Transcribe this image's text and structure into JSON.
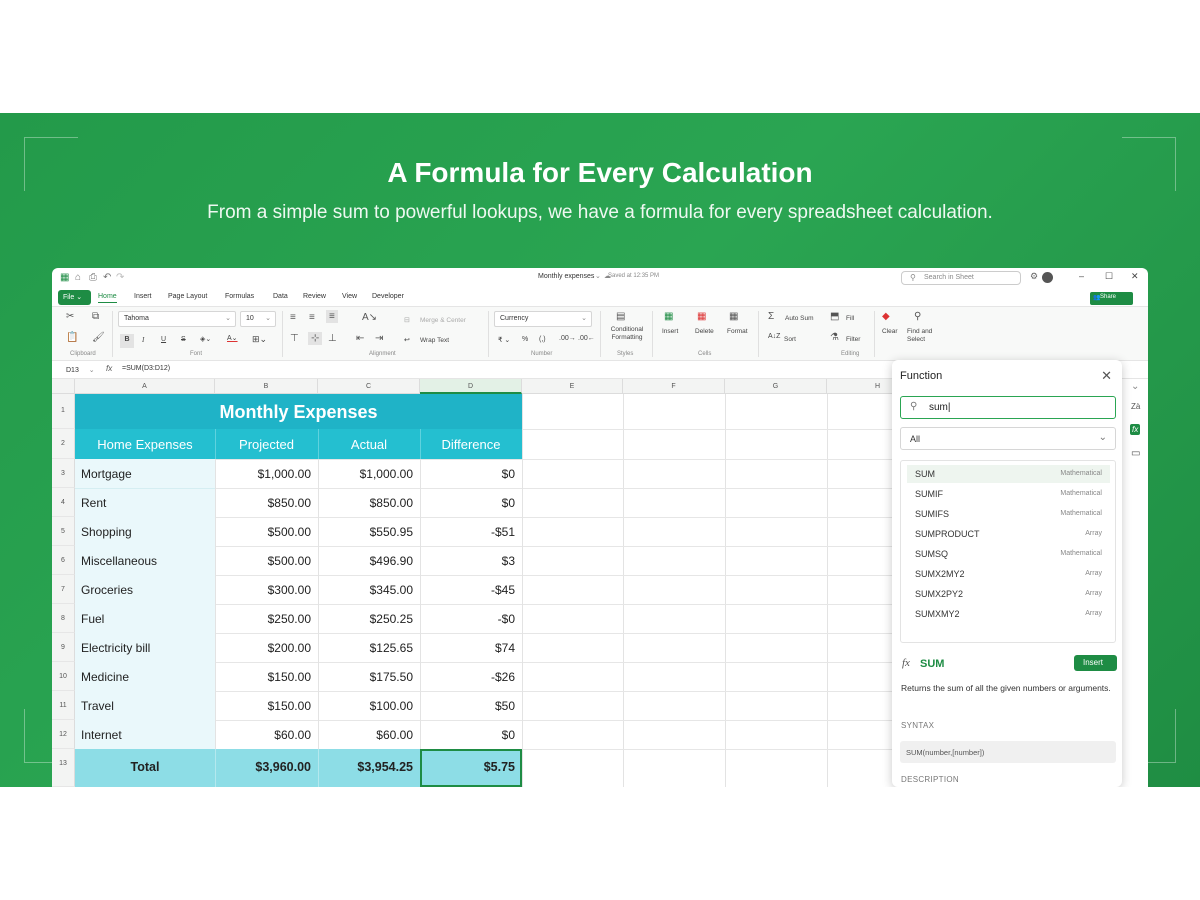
{
  "banner": {
    "headline": "A Formula for Every Calculation",
    "subheadline": "From a simple sum to powerful lookups, we have a formula for every spreadsheet calculation."
  },
  "titlebar": {
    "doc_title": "Monthly expenses",
    "saved_text": "Saved at 12:35 PM",
    "search_placeholder": "Search in Sheet"
  },
  "menu": {
    "file": "File",
    "items": [
      "Home",
      "Insert",
      "Page Layout",
      "Formulas",
      "Data",
      "Review",
      "View",
      "Developer"
    ],
    "share": "Share"
  },
  "ribbon": {
    "font_name": "Tahoma",
    "font_size": "10",
    "merge_center": "Merge & Center",
    "wrap_text": "Wrap Text",
    "number_format": "Currency",
    "conditional_formatting": "Conditional Formatting",
    "insert": "Insert",
    "delete": "Delete",
    "format": "Format",
    "auto_sum": "Auto Sum",
    "fill": "Fill",
    "sort": "Sort",
    "filter": "Filter",
    "clear": "Clear",
    "find_select": "Find and Select",
    "groups": {
      "clipboard": "Clipboard",
      "font": "Font",
      "alignment": "Alignment",
      "number": "Number",
      "styles": "Styles",
      "cells": "Cells",
      "editing": "Editing"
    }
  },
  "formula_bar": {
    "cell_ref": "D13",
    "fx": "fx",
    "formula": "=SUM(D3:D12)"
  },
  "sheet": {
    "columns": [
      "A",
      "B",
      "C",
      "D",
      "E",
      "F",
      "G",
      "H"
    ],
    "row_numbers": [
      "1",
      "2",
      "3",
      "4",
      "5",
      "6",
      "7",
      "8",
      "9",
      "10",
      "11",
      "12",
      "13"
    ],
    "title": "Monthly Expenses",
    "headers": [
      "Home Expenses",
      "Projected",
      "Actual",
      "Difference"
    ],
    "rows": [
      [
        "Mortgage",
        "$1,000.00",
        "$1,000.00",
        "$0"
      ],
      [
        "Rent",
        "$850.00",
        "$850.00",
        "$0"
      ],
      [
        "Shopping",
        "$500.00",
        "$550.95",
        "-$51"
      ],
      [
        "Miscellaneous",
        "$500.00",
        "$496.90",
        "$3"
      ],
      [
        "Groceries",
        "$300.00",
        "$345.00",
        "-$45"
      ],
      [
        "Fuel",
        "$250.00",
        "$250.25",
        "-$0"
      ],
      [
        "Electricity bill",
        "$200.00",
        "$125.65",
        "$74"
      ],
      [
        "Medicine",
        "$150.00",
        "$175.50",
        "-$26"
      ],
      [
        "Travel",
        "$150.00",
        "$100.00",
        "$50"
      ],
      [
        "Internet",
        "$60.00",
        "$60.00",
        "$0"
      ]
    ],
    "total": [
      "Total",
      "$3,960.00",
      "$3,954.25",
      "$5.75"
    ]
  },
  "function_panel": {
    "title": "Function",
    "search_value": "sum",
    "category": "All",
    "items": [
      {
        "name": "SUM",
        "category": "Mathematical"
      },
      {
        "name": "SUMIF",
        "category": "Mathematical"
      },
      {
        "name": "SUMIFS",
        "category": "Mathematical"
      },
      {
        "name": "SUMPRODUCT",
        "category": "Array"
      },
      {
        "name": "SUMSQ",
        "category": "Mathematical"
      },
      {
        "name": "SUMX2MY2",
        "category": "Array"
      },
      {
        "name": "SUMX2PY2",
        "category": "Array"
      },
      {
        "name": "SUMXMY2",
        "category": "Array"
      }
    ],
    "selected_function": "SUM",
    "insert_label": "Insert",
    "description": "Returns the sum of all the given numbers or arguments.",
    "syntax_label": "SYNTAX",
    "syntax": "SUM(number,[number])",
    "description_label": "DESCRIPTION"
  },
  "colors": {
    "brand_green": "#1e8c44",
    "banner_green": "#2aa552",
    "teal_header": "#1fb3c7",
    "teal_light": "#eaf8fb",
    "teal_total": "#8ddde6"
  }
}
